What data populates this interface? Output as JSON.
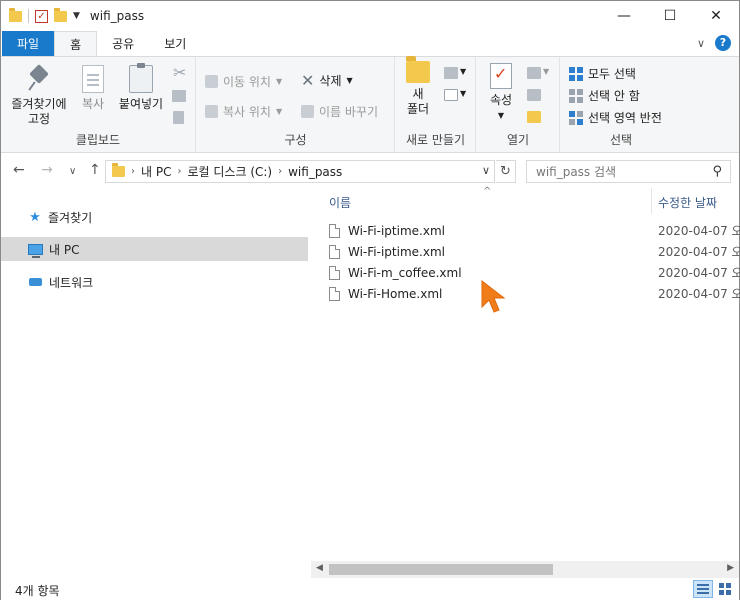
{
  "window": {
    "title": "wifi_pass",
    "controls": {
      "minimize": "—",
      "maximize": "☐",
      "close": "✕"
    }
  },
  "tabs": [
    {
      "label": "파일"
    },
    {
      "label": "홈"
    },
    {
      "label": "공유"
    },
    {
      "label": "보기"
    }
  ],
  "tabs_right": {
    "collapse": "∨",
    "help": "?"
  },
  "ribbon": {
    "clipboard": {
      "label": "클립보드",
      "pin_line1": "즐겨찾기에",
      "pin_line2": "고정",
      "copy": "복사",
      "paste": "붙여넣기"
    },
    "organize": {
      "label": "구성",
      "move_to": "이동 위치",
      "copy_to": "복사 위치",
      "delete": "삭제",
      "rename": "이름 바꾸기"
    },
    "new": {
      "label": "새로 만들기",
      "new_line1": "새",
      "new_line2": "폴더"
    },
    "open": {
      "label": "열기",
      "properties": "속성"
    },
    "select": {
      "label": "선택",
      "select_all": "모두 선택",
      "select_none": "선택 안 함",
      "invert": "선택 영역 반전"
    }
  },
  "nav": {
    "back": "←",
    "forward": "→",
    "recent": "∨",
    "up": "↑",
    "breadcrumb": [
      "내 PC",
      "로컬 디스크 (C:)",
      "wifi_pass"
    ],
    "search_placeholder": "wifi_pass 검색"
  },
  "navpane": {
    "items": [
      {
        "label": "즐겨찾기"
      },
      {
        "label": "내 PC"
      },
      {
        "label": "네트워크"
      }
    ]
  },
  "filelist": {
    "columns": {
      "name": "이름",
      "date": "수정한 날짜"
    },
    "files": [
      {
        "name": "Wi-Fi-iptime.xml",
        "date": "2020-04-07 오"
      },
      {
        "name": "Wi-Fi-iptime.xml",
        "date": "2020-04-07 오"
      },
      {
        "name": "Wi-Fi-m_coffee.xml",
        "date": "2020-04-07 오"
      },
      {
        "name": "Wi-Fi-Home.xml",
        "date": "2020-04-07 오"
      }
    ]
  },
  "status": {
    "count": "4개 항목"
  },
  "colors": {
    "file_tab": "#1979ca",
    "ribbon_bg": "#f5f6f7",
    "selected_nav": "#d9d9d9",
    "cursor": "#f07d1a"
  }
}
